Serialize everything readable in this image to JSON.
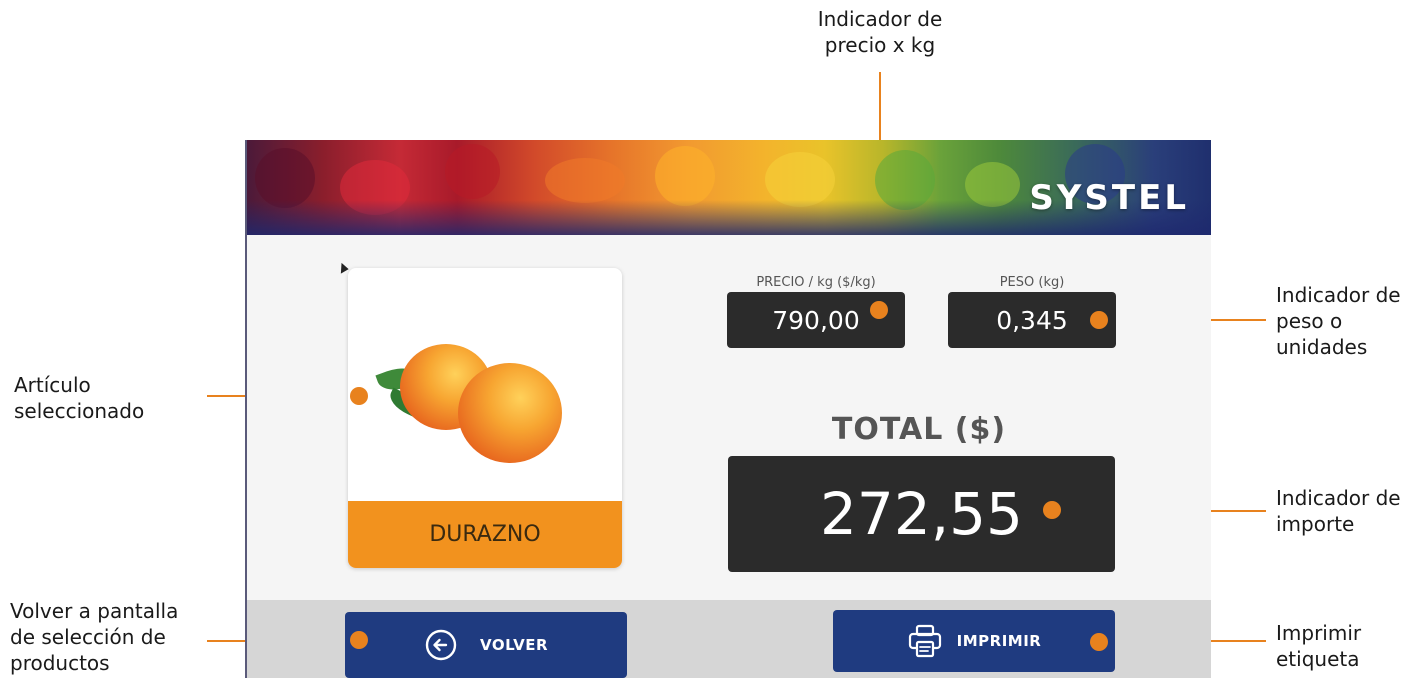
{
  "annotations": {
    "price": "Indicador de\nprecio x kg",
    "weight": "Indicador de\npeso o\nunidades",
    "article": "Artículo\nseleccionado",
    "amount": "Indicador de\nimporte",
    "back": "Volver a pantalla\nde selección de\nproductos",
    "print": "Imprimir\netiqueta"
  },
  "app": {
    "logo": "SYSTEL",
    "product": {
      "name": "DURAZNO",
      "image_icon": "peach-image"
    },
    "price": {
      "label": "PRECIO / kg ($/kg)",
      "value": "790,00"
    },
    "weight": {
      "label": "PESO (kg)",
      "value": "0,345"
    },
    "total": {
      "label": "TOTAL ($)",
      "value": "272,55"
    },
    "buttons": {
      "back": {
        "label": "VOLVER",
        "icon": "arrow-left-circle-icon"
      },
      "print": {
        "label": "IMPRIMIR",
        "icon": "printer-icon"
      }
    }
  },
  "colors": {
    "accent": "#e8821e",
    "product_label_bg": "#f2921e",
    "button_bg": "#1f3b80",
    "display_bg": "#2b2b2b"
  }
}
